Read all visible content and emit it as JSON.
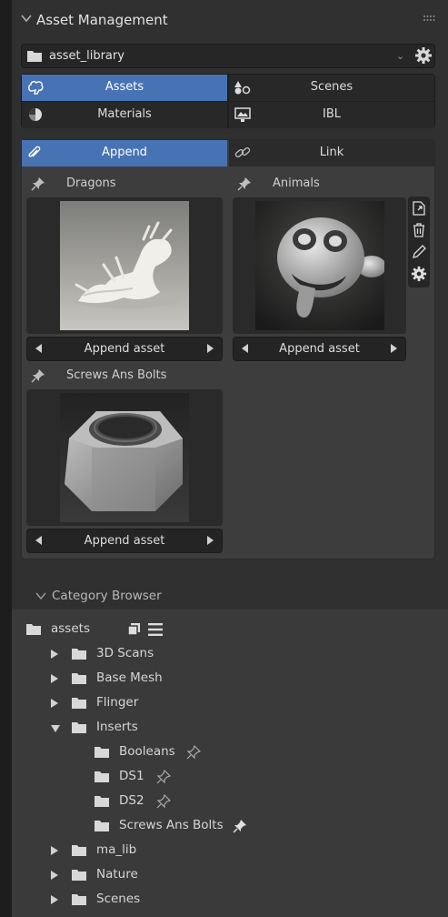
{
  "panel": {
    "title": "Asset Management"
  },
  "library": {
    "selected": "asset_library"
  },
  "mode_tabs": [
    {
      "label": "Assets",
      "icon": "brain-icon",
      "active": true
    },
    {
      "label": "Scenes",
      "icon": "shapes-icon",
      "active": false
    },
    {
      "label": "Materials",
      "icon": "material-sphere-icon",
      "active": false
    },
    {
      "label": "IBL",
      "icon": "image-monitor-icon",
      "active": false
    }
  ],
  "import_mode": {
    "append_label": "Append",
    "link_label": "Link",
    "active": "Append"
  },
  "assets": [
    {
      "title": "Dragons",
      "button": "Append asset",
      "thumbnail": "dragon-statue"
    },
    {
      "title": "Animals",
      "button": "Append asset",
      "thumbnail": "monkey-head"
    },
    {
      "title": "Screws Ans Bolts",
      "button": "Append asset",
      "thumbnail": "hex-nut"
    }
  ],
  "side_tools": [
    "open-external-icon",
    "trash-icon",
    "pencil-icon",
    "gear-icon"
  ],
  "category_browser": {
    "title": "Category Browser",
    "root": "assets",
    "items": [
      {
        "label": "3D Scans",
        "expanded": false,
        "pinned": false
      },
      {
        "label": "Base Mesh",
        "expanded": false,
        "pinned": false
      },
      {
        "label": "Flinger",
        "expanded": false,
        "pinned": false
      },
      {
        "label": "Inserts",
        "expanded": true,
        "pinned": false
      },
      {
        "label": "Booleans",
        "expanded": false,
        "pinned": false
      },
      {
        "label": "DS1",
        "expanded": false,
        "pinned": false
      },
      {
        "label": "DS2",
        "expanded": false,
        "pinned": false
      },
      {
        "label": "Screws Ans Bolts",
        "expanded": false,
        "pinned": true
      },
      {
        "label": "ma_lib",
        "expanded": false,
        "pinned": false
      },
      {
        "label": "Nature",
        "expanded": false,
        "pinned": false
      },
      {
        "label": "Scenes",
        "expanded": false,
        "pinned": false
      }
    ]
  },
  "colors": {
    "accent": "#4772b3",
    "panel_bg": "#303030",
    "tree_bg": "#3a3a3a"
  }
}
